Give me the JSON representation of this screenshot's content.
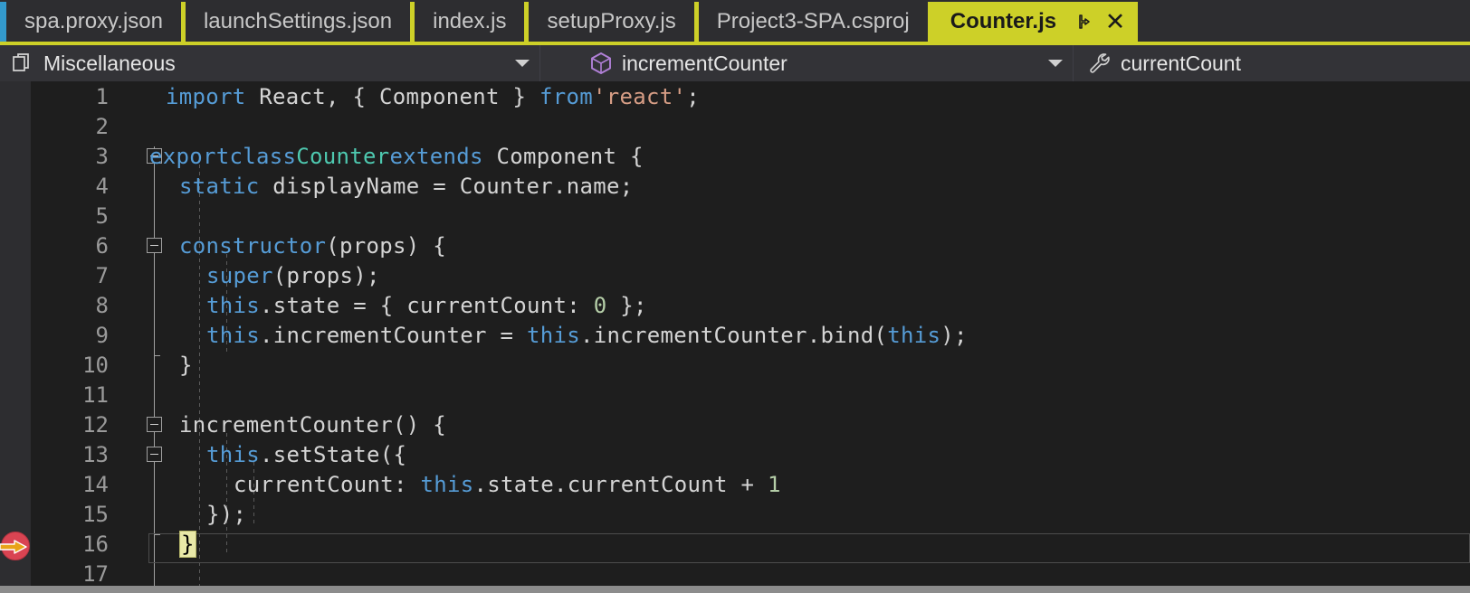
{
  "window": {
    "accent_color": "#cdd028",
    "editor_background": "#1e1e1e",
    "margin_background": "#2d2d30",
    "navbar_background": "#333337"
  },
  "tabs": {
    "overflow_indicator": "tab-overflow-strip",
    "items": [
      {
        "label": "spa.proxy.json",
        "active": false
      },
      {
        "label": "launchSettings.json",
        "active": false
      },
      {
        "label": "index.js",
        "active": false
      },
      {
        "label": "setupProxy.js",
        "active": false
      },
      {
        "label": "Project3-SPA.csproj",
        "active": false
      },
      {
        "label": "Counter.js",
        "active": true
      }
    ],
    "active_tab_pin_icon": "pin-icon",
    "active_tab_close_icon": "close-icon",
    "active_tab_close_glyph": "✕"
  },
  "navbar": {
    "project_selector": {
      "value": "Miscellaneous",
      "icon": "documents-icon"
    },
    "member_selector": {
      "value": "incrementCounter",
      "icon": "method-cube-icon"
    },
    "symbol_selector": {
      "value": "currentCount",
      "icon": "wrench-icon"
    }
  },
  "editor": {
    "language": "javascript",
    "file": "Counter.js",
    "current_line": 16,
    "breakpoint_line": 16,
    "current_statement_marker": "yellow-arrow-on-breakpoint",
    "matched_brace_text": "}",
    "lines": [
      {
        "n": "1",
        "text": "    import React, { Component } from 'react';"
      },
      {
        "n": "2",
        "text": ""
      },
      {
        "n": "3",
        "text": "  export class Counter extends Component {"
      },
      {
        "n": "4",
        "text": "    static displayName = Counter.name;"
      },
      {
        "n": "5",
        "text": ""
      },
      {
        "n": "6",
        "text": "    constructor(props) {"
      },
      {
        "n": "7",
        "text": "      super(props);"
      },
      {
        "n": "8",
        "text": "      this.state = { currentCount: 0 };"
      },
      {
        "n": "9",
        "text": "      this.incrementCounter = this.incrementCounter.bind(this);"
      },
      {
        "n": "10",
        "text": "    }"
      },
      {
        "n": "11",
        "text": ""
      },
      {
        "n": "12",
        "text": "    incrementCounter() {"
      },
      {
        "n": "13",
        "text": "      this.setState({"
      },
      {
        "n": "14",
        "text": "        currentCount: this.state.currentCount + 1"
      },
      {
        "n": "15",
        "text": "      });"
      },
      {
        "n": "16",
        "text": "    }"
      },
      {
        "n": "17",
        "text": ""
      }
    ],
    "fold_lines": [
      "3",
      "6",
      "12",
      "13"
    ],
    "syntax_colors": {
      "keyword": "#569cd6",
      "class_name": "#4ec9b0",
      "string": "#d69d85",
      "number": "#b5cea8",
      "plain": "#d4d4d4",
      "line_number": "#9a9a9a"
    }
  },
  "scrollbar": {
    "orientation": "horizontal",
    "name": "horizontal-scrollbar"
  }
}
